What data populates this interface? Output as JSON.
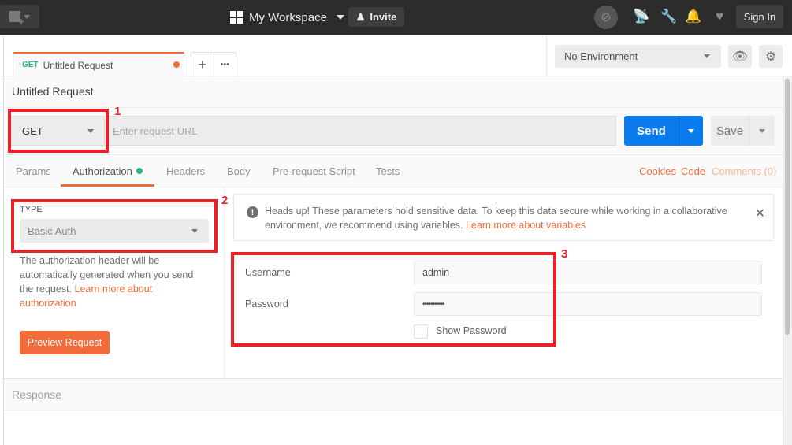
{
  "topbar": {
    "workspace": "My Workspace",
    "invite_label": "Invite",
    "signin_label": "Sign In",
    "icons": [
      "new-icon",
      "sync-off-icon",
      "interceptor-icon",
      "settings-wrench-icon",
      "notifications-bell-icon",
      "heart-icon"
    ]
  },
  "tabs_bar": {
    "open_tab": {
      "method": "GET",
      "name": "Untitled Request",
      "unsaved": true
    },
    "add_label": "+",
    "more_label": "•••"
  },
  "environment": {
    "selected": "No Environment"
  },
  "request": {
    "title": "Untitled Request",
    "method": "GET",
    "url_value": "",
    "url_placeholder": "Enter request URL",
    "send_label": "Send",
    "save_label": "Save"
  },
  "request_tabs": {
    "items": [
      {
        "label": "Params",
        "active": false
      },
      {
        "label": "Authorization",
        "active": true,
        "indicator": true
      },
      {
        "label": "Headers",
        "active": false
      },
      {
        "label": "Body",
        "active": false
      },
      {
        "label": "Pre-request Script",
        "active": false
      },
      {
        "label": "Tests",
        "active": false
      }
    ],
    "right_links": [
      {
        "label": "Cookies",
        "color": "#f26b3a"
      },
      {
        "label": "Code",
        "color": "#f26b3a"
      },
      {
        "label": "Comments (0)",
        "color": "#f9b39a"
      }
    ]
  },
  "auth": {
    "type_label": "TYPE",
    "type_value": "Basic Auth",
    "description": "The authorization header will be automatically generated when you send the request. ",
    "description_link": "Learn more about authorization",
    "preview_label": "Preview Request",
    "alert_text": "Heads up! These parameters hold sensitive data. To keep this data secure while working in a collaborative environment, we recommend using variables. ",
    "alert_link": "Learn more about variables",
    "alert_close": "✕",
    "username_label": "Username",
    "username_value": "admin",
    "password_label": "Password",
    "password_value": "•••••••••••",
    "show_password_label": "Show Password",
    "show_password_checked": false
  },
  "response": {
    "label": "Response"
  },
  "annotations": [
    "1",
    "2",
    "3"
  ],
  "colors": {
    "accent": "#f26b3a",
    "send": "#097bed",
    "get_method": "#26b47f",
    "annotation": "#e8212b"
  }
}
